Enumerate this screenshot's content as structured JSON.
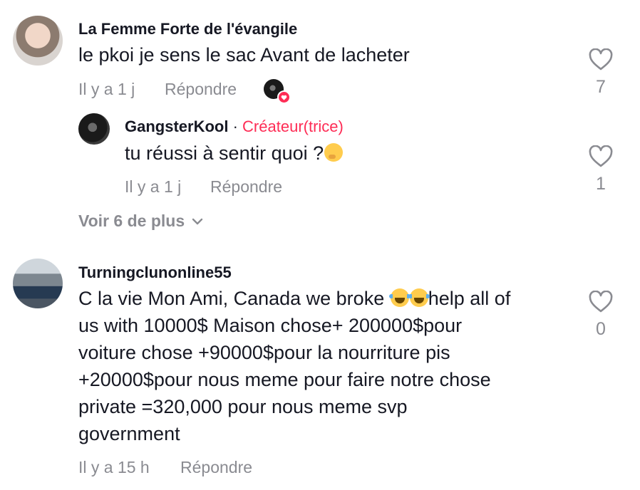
{
  "comments": [
    {
      "username": "La Femme Forte de l'évangile",
      "text": "le pkoi je sens le sac Avant de lacheter",
      "time": "Il y a 1 j",
      "reply_label": "Répondre",
      "likes": "7"
    },
    {
      "username": "GangsterKool",
      "separator": "·",
      "creator_label": "Créateur(trice)",
      "text": "tu réussi à sentir quoi ?",
      "emoji": "thinking-face",
      "time": "Il y a 1 j",
      "reply_label": "Répondre",
      "likes": "1"
    },
    {
      "username": "Turningclunonline55",
      "text_lines": [
        "C la vie Mon Ami, Canada we broke",
        "help all of",
        "us with 10000$ Maison chose+ 200000$pour",
        "voiture chose +90000$pour la nourriture pis",
        "+20000$pour nous meme pour faire notre chose",
        "private =320,000 pour nous meme svp",
        "government"
      ],
      "emoji": "face-with-tears-of-joy",
      "time": "Il y a 15 h",
      "reply_label": "Répondre",
      "likes": "0"
    }
  ],
  "more_replies": "Voir 6 de plus",
  "colors": {
    "accent": "#fe2c55",
    "muted": "#8a8b91",
    "text": "#161823"
  },
  "icons": [
    "heart-outline-icon",
    "chevron-down-icon",
    "heart-badge-icon"
  ]
}
